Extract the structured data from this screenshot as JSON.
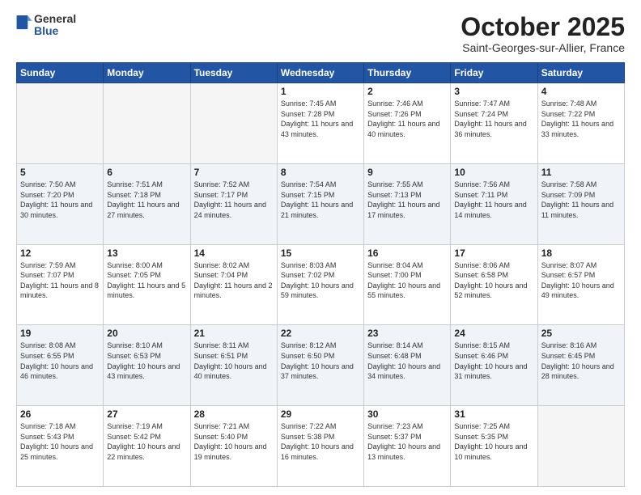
{
  "header": {
    "logo_general": "General",
    "logo_blue": "Blue",
    "month_title": "October 2025",
    "subtitle": "Saint-Georges-sur-Allier, France"
  },
  "weekdays": [
    "Sunday",
    "Monday",
    "Tuesday",
    "Wednesday",
    "Thursday",
    "Friday",
    "Saturday"
  ],
  "weeks": [
    [
      {
        "day": "",
        "empty": true
      },
      {
        "day": "",
        "empty": true
      },
      {
        "day": "",
        "empty": true
      },
      {
        "day": "1",
        "sunrise": "Sunrise: 7:45 AM",
        "sunset": "Sunset: 7:28 PM",
        "daylight": "Daylight: 11 hours and 43 minutes."
      },
      {
        "day": "2",
        "sunrise": "Sunrise: 7:46 AM",
        "sunset": "Sunset: 7:26 PM",
        "daylight": "Daylight: 11 hours and 40 minutes."
      },
      {
        "day": "3",
        "sunrise": "Sunrise: 7:47 AM",
        "sunset": "Sunset: 7:24 PM",
        "daylight": "Daylight: 11 hours and 36 minutes."
      },
      {
        "day": "4",
        "sunrise": "Sunrise: 7:48 AM",
        "sunset": "Sunset: 7:22 PM",
        "daylight": "Daylight: 11 hours and 33 minutes."
      }
    ],
    [
      {
        "day": "5",
        "sunrise": "Sunrise: 7:50 AM",
        "sunset": "Sunset: 7:20 PM",
        "daylight": "Daylight: 11 hours and 30 minutes."
      },
      {
        "day": "6",
        "sunrise": "Sunrise: 7:51 AM",
        "sunset": "Sunset: 7:18 PM",
        "daylight": "Daylight: 11 hours and 27 minutes."
      },
      {
        "day": "7",
        "sunrise": "Sunrise: 7:52 AM",
        "sunset": "Sunset: 7:17 PM",
        "daylight": "Daylight: 11 hours and 24 minutes."
      },
      {
        "day": "8",
        "sunrise": "Sunrise: 7:54 AM",
        "sunset": "Sunset: 7:15 PM",
        "daylight": "Daylight: 11 hours and 21 minutes."
      },
      {
        "day": "9",
        "sunrise": "Sunrise: 7:55 AM",
        "sunset": "Sunset: 7:13 PM",
        "daylight": "Daylight: 11 hours and 17 minutes."
      },
      {
        "day": "10",
        "sunrise": "Sunrise: 7:56 AM",
        "sunset": "Sunset: 7:11 PM",
        "daylight": "Daylight: 11 hours and 14 minutes."
      },
      {
        "day": "11",
        "sunrise": "Sunrise: 7:58 AM",
        "sunset": "Sunset: 7:09 PM",
        "daylight": "Daylight: 11 hours and 11 minutes."
      }
    ],
    [
      {
        "day": "12",
        "sunrise": "Sunrise: 7:59 AM",
        "sunset": "Sunset: 7:07 PM",
        "daylight": "Daylight: 11 hours and 8 minutes."
      },
      {
        "day": "13",
        "sunrise": "Sunrise: 8:00 AM",
        "sunset": "Sunset: 7:05 PM",
        "daylight": "Daylight: 11 hours and 5 minutes."
      },
      {
        "day": "14",
        "sunrise": "Sunrise: 8:02 AM",
        "sunset": "Sunset: 7:04 PM",
        "daylight": "Daylight: 11 hours and 2 minutes."
      },
      {
        "day": "15",
        "sunrise": "Sunrise: 8:03 AM",
        "sunset": "Sunset: 7:02 PM",
        "daylight": "Daylight: 10 hours and 59 minutes."
      },
      {
        "day": "16",
        "sunrise": "Sunrise: 8:04 AM",
        "sunset": "Sunset: 7:00 PM",
        "daylight": "Daylight: 10 hours and 55 minutes."
      },
      {
        "day": "17",
        "sunrise": "Sunrise: 8:06 AM",
        "sunset": "Sunset: 6:58 PM",
        "daylight": "Daylight: 10 hours and 52 minutes."
      },
      {
        "day": "18",
        "sunrise": "Sunrise: 8:07 AM",
        "sunset": "Sunset: 6:57 PM",
        "daylight": "Daylight: 10 hours and 49 minutes."
      }
    ],
    [
      {
        "day": "19",
        "sunrise": "Sunrise: 8:08 AM",
        "sunset": "Sunset: 6:55 PM",
        "daylight": "Daylight: 10 hours and 46 minutes."
      },
      {
        "day": "20",
        "sunrise": "Sunrise: 8:10 AM",
        "sunset": "Sunset: 6:53 PM",
        "daylight": "Daylight: 10 hours and 43 minutes."
      },
      {
        "day": "21",
        "sunrise": "Sunrise: 8:11 AM",
        "sunset": "Sunset: 6:51 PM",
        "daylight": "Daylight: 10 hours and 40 minutes."
      },
      {
        "day": "22",
        "sunrise": "Sunrise: 8:12 AM",
        "sunset": "Sunset: 6:50 PM",
        "daylight": "Daylight: 10 hours and 37 minutes."
      },
      {
        "day": "23",
        "sunrise": "Sunrise: 8:14 AM",
        "sunset": "Sunset: 6:48 PM",
        "daylight": "Daylight: 10 hours and 34 minutes."
      },
      {
        "day": "24",
        "sunrise": "Sunrise: 8:15 AM",
        "sunset": "Sunset: 6:46 PM",
        "daylight": "Daylight: 10 hours and 31 minutes."
      },
      {
        "day": "25",
        "sunrise": "Sunrise: 8:16 AM",
        "sunset": "Sunset: 6:45 PM",
        "daylight": "Daylight: 10 hours and 28 minutes."
      }
    ],
    [
      {
        "day": "26",
        "sunrise": "Sunrise: 7:18 AM",
        "sunset": "Sunset: 5:43 PM",
        "daylight": "Daylight: 10 hours and 25 minutes."
      },
      {
        "day": "27",
        "sunrise": "Sunrise: 7:19 AM",
        "sunset": "Sunset: 5:42 PM",
        "daylight": "Daylight: 10 hours and 22 minutes."
      },
      {
        "day": "28",
        "sunrise": "Sunrise: 7:21 AM",
        "sunset": "Sunset: 5:40 PM",
        "daylight": "Daylight: 10 hours and 19 minutes."
      },
      {
        "day": "29",
        "sunrise": "Sunrise: 7:22 AM",
        "sunset": "Sunset: 5:38 PM",
        "daylight": "Daylight: 10 hours and 16 minutes."
      },
      {
        "day": "30",
        "sunrise": "Sunrise: 7:23 AM",
        "sunset": "Sunset: 5:37 PM",
        "daylight": "Daylight: 10 hours and 13 minutes."
      },
      {
        "day": "31",
        "sunrise": "Sunrise: 7:25 AM",
        "sunset": "Sunset: 5:35 PM",
        "daylight": "Daylight: 10 hours and 10 minutes."
      },
      {
        "day": "",
        "empty": true
      }
    ]
  ]
}
